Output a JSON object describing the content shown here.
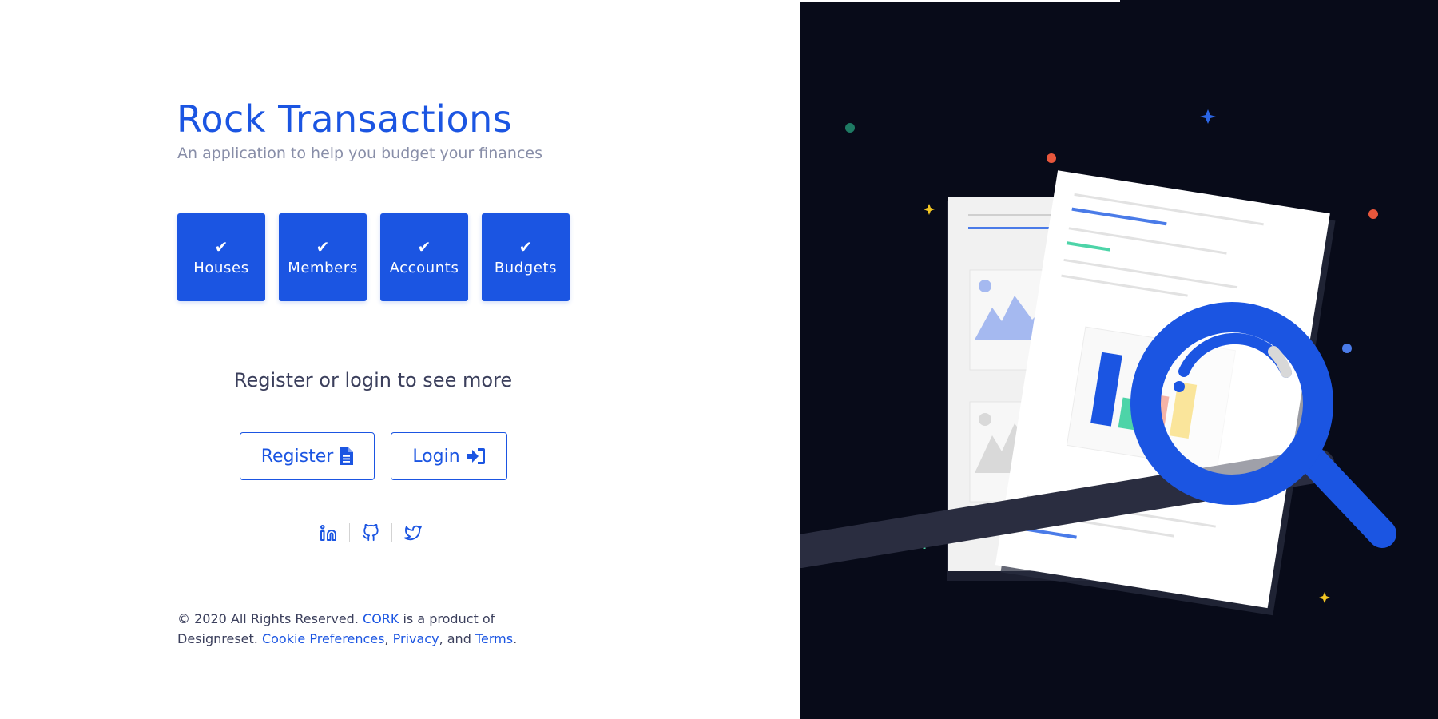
{
  "header": {
    "title": "Rock Transactions",
    "subtitle": "An application to help you budget your finances"
  },
  "features": [
    {
      "label": "Houses",
      "icon": "check-icon"
    },
    {
      "label": "Members",
      "icon": "check-icon"
    },
    {
      "label": "Accounts",
      "icon": "check-icon"
    },
    {
      "label": "Budgets",
      "icon": "check-icon"
    }
  ],
  "auth": {
    "prompt": "Register or login to see more",
    "register_label": "Register",
    "register_icon": "file-text-icon",
    "login_label": "Login",
    "login_icon": "sign-in-icon"
  },
  "social": [
    "linkedin-icon",
    "github-icon",
    "twitter-icon"
  ],
  "footer": {
    "copyright": "© 2020 All Rights Reserved.",
    "brand_link": "CORK",
    "is_product_of": "is a product of Designreset.",
    "cookie_link": "Cookie Preferences",
    "comma": ",",
    "privacy_link": "Privacy",
    "and_text": ", and",
    "terms_link": "Terms",
    "period": "."
  },
  "colors": {
    "accent": "#1b55e2",
    "dark_panel": "#080b19",
    "muted_text": "#888ea8",
    "body_text": "#3b3f5c"
  }
}
